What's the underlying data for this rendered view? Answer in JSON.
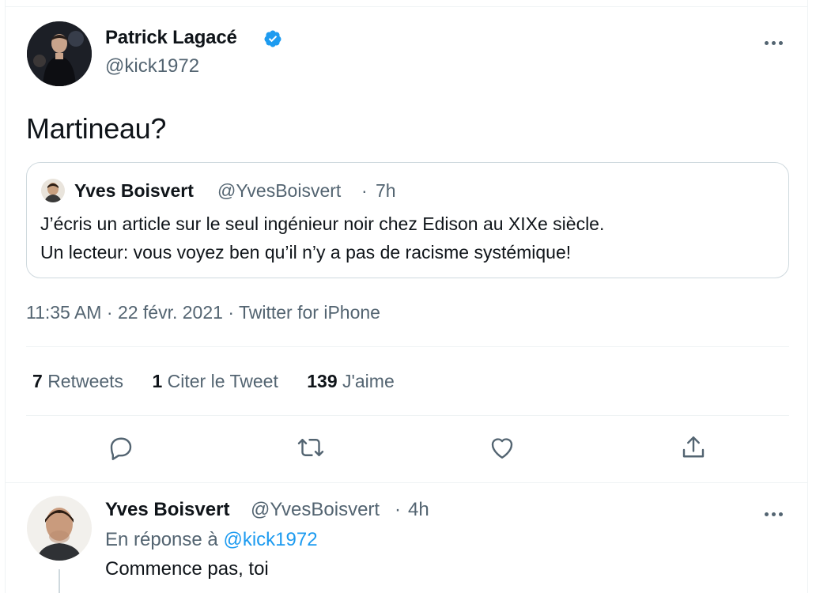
{
  "colors": {
    "text": "#0f1419",
    "secondary": "#536471",
    "accent": "#1d9bf0",
    "border": "#cfd9de"
  },
  "tweet": {
    "author_name": "Patrick Lagacé",
    "author_handle": "@kick1972",
    "verified_icon": "verified-badge-icon",
    "text": "Martineau?",
    "quote": {
      "author_name": "Yves Boisvert",
      "author_handle": "@YvesBoisvert",
      "separator": "·",
      "time": "7h",
      "line1": "J’écris un article sur le seul ingénieur noir chez Edison au XIXe siècle.",
      "line2": "Un lecteur: vous voyez ben qu’il n’y a pas de racisme systémique!"
    },
    "time": "11:35 AM",
    "date": "22 févr. 2021",
    "source": "Twitter for iPhone",
    "meta_separator": "·",
    "stats": [
      {
        "count": "7",
        "label": "Retweets"
      },
      {
        "count": "1",
        "label": "Citer le Tweet"
      },
      {
        "count": "139",
        "label": "J'aime"
      }
    ],
    "actions": [
      "reply-icon",
      "retweet-icon",
      "like-icon",
      "share-icon"
    ]
  },
  "reply": {
    "author_name": "Yves Boisvert",
    "author_handle": "@YvesBoisvert",
    "separator": "·",
    "time": "4h",
    "reply_prefix": "En réponse à",
    "reply_to": "@kick1972",
    "text": "Commence pas, toi"
  }
}
